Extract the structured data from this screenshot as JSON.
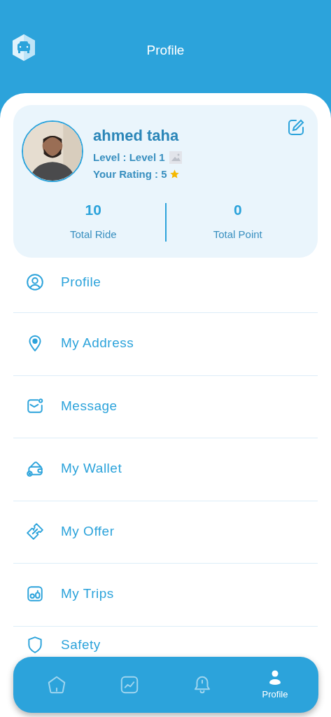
{
  "header": {
    "title": "Profile"
  },
  "profile_card": {
    "name": "ahmed taha",
    "level": "Level : Level 1",
    "rating": "Your Rating : 5",
    "stats": [
      {
        "value": "10",
        "label": "Total Ride"
      },
      {
        "value": "0",
        "label": "Total Point"
      }
    ]
  },
  "menu": [
    {
      "kind": "profile",
      "label": "Profile"
    },
    {
      "kind": "address",
      "label": "My Address"
    },
    {
      "kind": "message",
      "label": "Message"
    },
    {
      "kind": "wallet",
      "label": "My Wallet"
    },
    {
      "kind": "offer",
      "label": "My Offer"
    },
    {
      "kind": "trips",
      "label": "My Trips"
    },
    {
      "kind": "safety",
      "label": "Safety"
    }
  ],
  "bottom_nav": [
    {
      "kind": "home",
      "selected": false
    },
    {
      "kind": "chart",
      "selected": false
    },
    {
      "kind": "bell",
      "selected": false
    },
    {
      "kind": "profile",
      "selected": true,
      "label": "Profile"
    }
  ]
}
